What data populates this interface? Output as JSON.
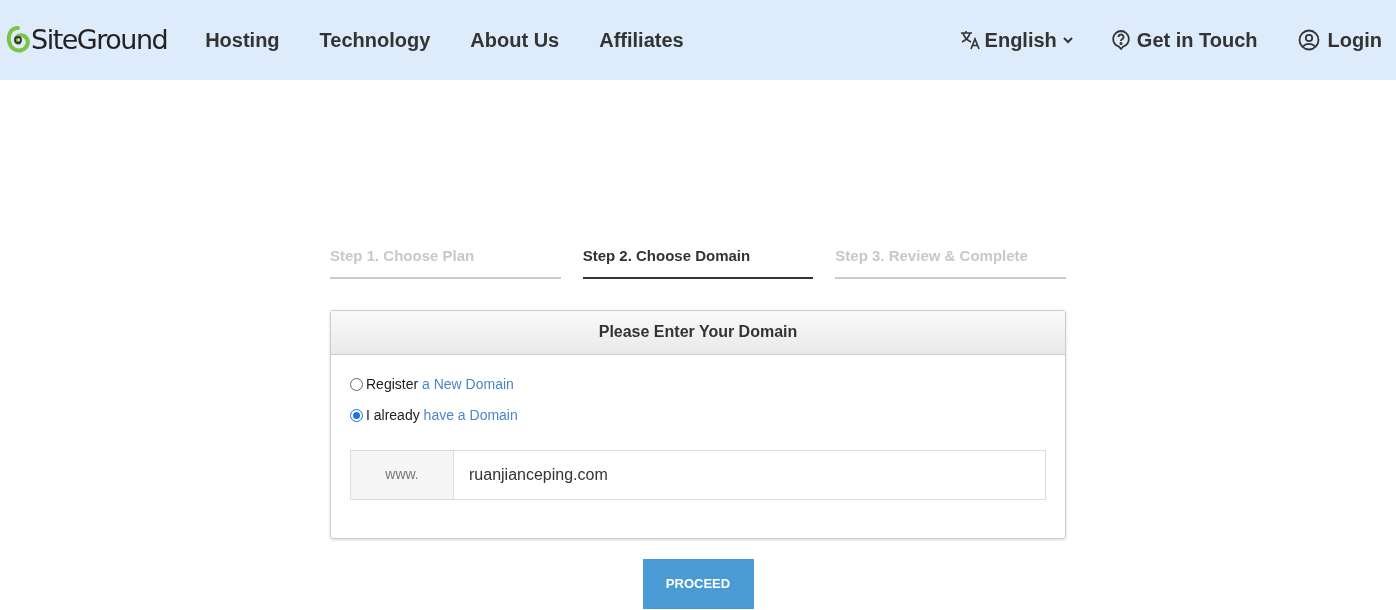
{
  "header": {
    "logo": "SiteGround",
    "nav": [
      "Hosting",
      "Technology",
      "About Us",
      "Affiliates"
    ],
    "language": "English",
    "contact": "Get in Touch",
    "login": "Login"
  },
  "steps": [
    {
      "label": "Step 1. Choose Plan",
      "selected": false
    },
    {
      "label": "Step 2. Choose Domain",
      "selected": true
    },
    {
      "label": "Step 3. Review & Complete",
      "selected": false
    }
  ],
  "panel": {
    "title": "Please Enter Your Domain",
    "options": [
      {
        "text": "Register",
        "link": "a New Domain",
        "selected": false
      },
      {
        "text": "I already",
        "link": "have a Domain",
        "selected": true
      }
    ],
    "prefix": "www.",
    "domain": "ruanjianceping.com"
  },
  "button": "PROCEED"
}
